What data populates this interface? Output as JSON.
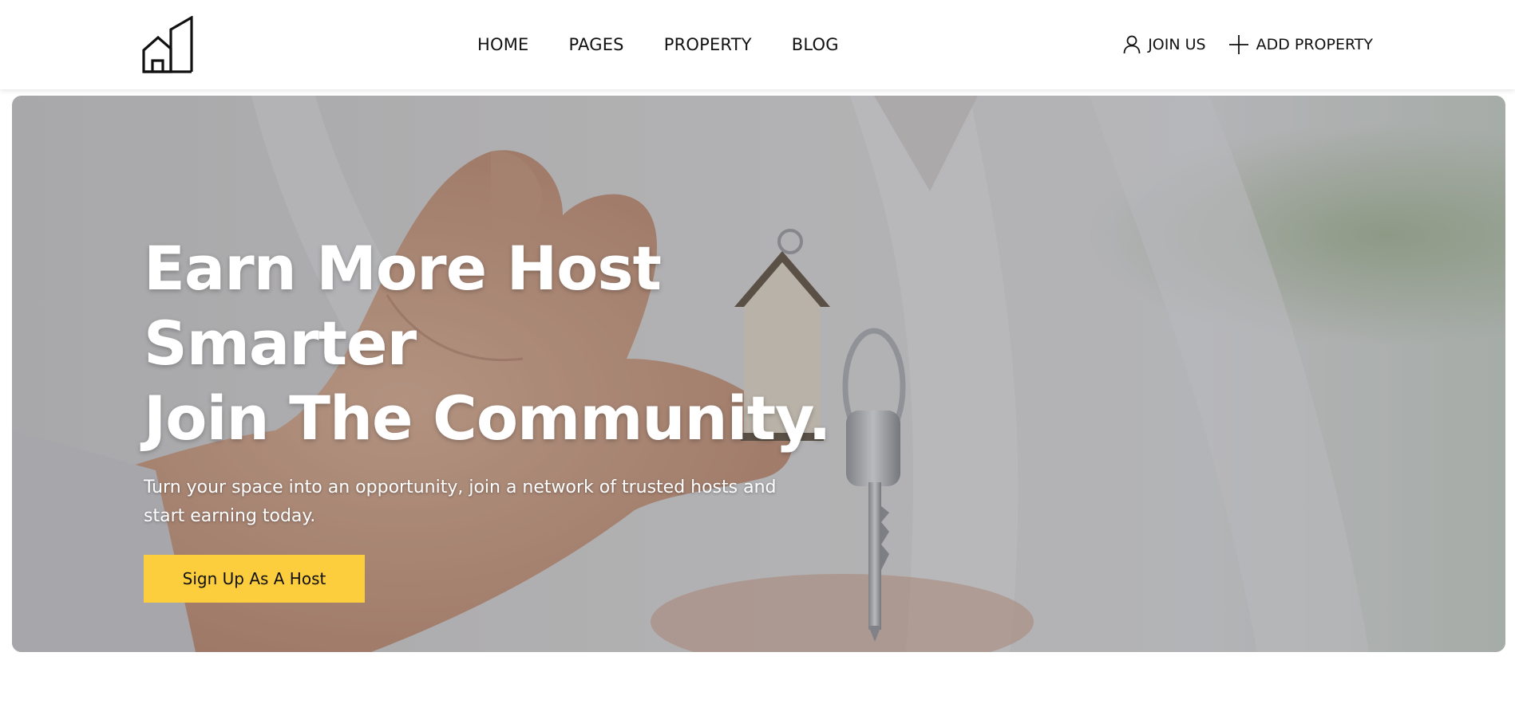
{
  "header": {
    "logo_icon": "building-logo-icon",
    "nav": [
      {
        "label": "HOME"
      },
      {
        "label": "PAGES"
      },
      {
        "label": "PROPERTY"
      },
      {
        "label": "BLOG"
      }
    ],
    "actions": {
      "join": {
        "label": "JOIN US",
        "icon": "user-icon"
      },
      "add_property": {
        "label": "ADD PROPERTY",
        "icon": "plus-icon"
      }
    }
  },
  "hero": {
    "title_line1": "Earn More Host Smarter",
    "title_line2": "Join The Community.",
    "subtitle": "Turn your space into an opportunity, join a network of trusted hosts and start earning today.",
    "cta_label": "Sign Up As A Host",
    "background_image": "hand-holding-house-keychain-photo"
  },
  "colors": {
    "accent": "#fccd3c",
    "text_dark": "#111111",
    "text_light": "#ffffff",
    "header_bg": "#ffffff"
  }
}
